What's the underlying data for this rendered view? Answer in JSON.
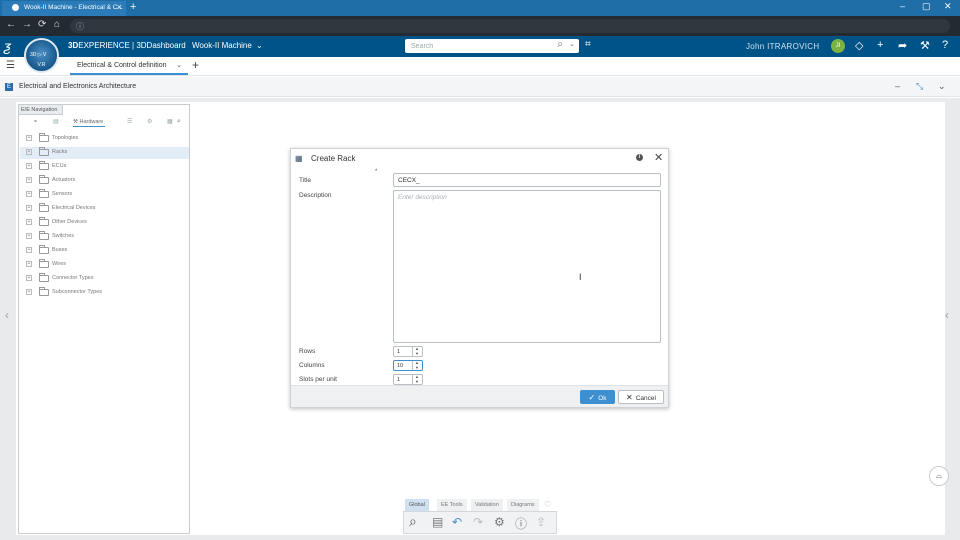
{
  "browser": {
    "tab_title": "Wook-II Machine - Electrical & C...",
    "tab_close": "×",
    "new_tab": "+",
    "win_minimize": "–",
    "win_restore": "▢",
    "win_close": "✕"
  },
  "appbar": {
    "brand_prefix": "3D",
    "brand_main": "EXPERIENCE | 3DDashboard",
    "dashboard_name": "Wook-II Machine",
    "dashboard_dropdown": "⌄",
    "search_placeholder": "Search",
    "user_name": "John ITRAROVICH",
    "avatar_initials": "JI",
    "compass_version": "V.R",
    "compass_play": "3D ▷ V"
  },
  "dashbar": {
    "active_tab": "Electrical & Control definition",
    "tab_dropdown": "⌄",
    "add_tab": "+"
  },
  "widget": {
    "title": "Electrical and Electronics Architecture",
    "icon_letter": "E"
  },
  "navpanel": {
    "tab_label": "E/E Navigation",
    "hardware_label": "Hardware",
    "tree": [
      {
        "label": "Topologies",
        "expander": "+",
        "selected": false
      },
      {
        "label": "Racks",
        "expander": "+",
        "selected": true
      },
      {
        "label": "ECUs",
        "expander": "+",
        "selected": false
      },
      {
        "label": "Actuators",
        "expander": "+",
        "selected": false
      },
      {
        "label": "Sensors",
        "expander": "+",
        "selected": false
      },
      {
        "label": "Electrical Devices",
        "expander": "+",
        "selected": false
      },
      {
        "label": "Other Devices",
        "expander": "+",
        "selected": false
      },
      {
        "label": "Switches",
        "expander": "+",
        "selected": false
      },
      {
        "label": "Buses",
        "expander": "+",
        "selected": false
      },
      {
        "label": "Wires",
        "expander": "+",
        "selected": false
      },
      {
        "label": "Connector Types",
        "expander": "+",
        "selected": false
      },
      {
        "label": "Subconnector Types",
        "expander": "+",
        "selected": false
      }
    ]
  },
  "dialog": {
    "title": "Create Rack",
    "required_marker": "*",
    "info": "i",
    "fields": {
      "title_label": "Title",
      "title_value": "CECX_",
      "description_label": "Description",
      "description_placeholder": "Enter description",
      "rows_label": "Rows",
      "rows_value": "1",
      "columns_label": "Columns",
      "columns_value": "10",
      "slots_label": "Slots per unit",
      "slots_value": "1"
    },
    "ok_label": "Ok",
    "cancel_label": "Cancel"
  },
  "actionbar": {
    "tabs": [
      "Global",
      "EE Tools",
      "Validation",
      "Diagrams"
    ],
    "active_tab": "Global"
  },
  "colors": {
    "appbar": "#005386",
    "accent": "#3d8fd0",
    "selection": "#e3edf7",
    "avatar": "#7bb342"
  }
}
